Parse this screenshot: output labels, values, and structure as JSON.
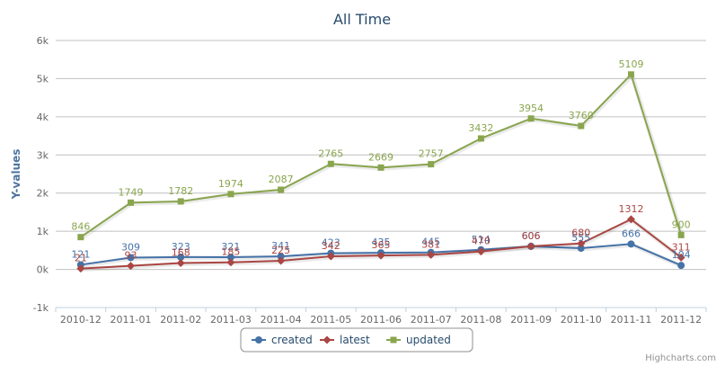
{
  "chart_data": {
    "type": "line",
    "title": "All Time",
    "ylabel": "Y-values",
    "xlabel": "",
    "categories": [
      "2010-12",
      "2011-01",
      "2011-02",
      "2011-03",
      "2011-04",
      "2011-05",
      "2011-06",
      "2011-07",
      "2011-08",
      "2011-09",
      "2011-10",
      "2011-11",
      "2011-12"
    ],
    "ylim": [
      -1000,
      6000
    ],
    "yticks": [
      "-1k",
      "0k",
      "1k",
      "2k",
      "3k",
      "4k",
      "5k",
      "6k"
    ],
    "ytick_values": [
      -1000,
      0,
      1000,
      2000,
      3000,
      4000,
      5000,
      6000
    ],
    "grid": true,
    "legend_position": "bottom-center",
    "series": [
      {
        "name": "created",
        "color": "#4572a7",
        "marker": "circle",
        "values": [
          121,
          309,
          323,
          321,
          341,
          423,
          435,
          445,
          514,
          606,
          555,
          666,
          104
        ]
      },
      {
        "name": "latest",
        "color": "#aa4643",
        "marker": "diamond",
        "values": [
          21,
          93,
          168,
          185,
          225,
          342,
          365,
          381,
          470,
          606,
          680,
          1312,
          311
        ]
      },
      {
        "name": "updated",
        "color": "#89a54e",
        "marker": "square",
        "values": [
          846,
          1749,
          1782,
          1974,
          2087,
          2765,
          2669,
          2757,
          3432,
          3954,
          3760,
          5109,
          900
        ]
      }
    ]
  },
  "credits": "Highcharts.com"
}
